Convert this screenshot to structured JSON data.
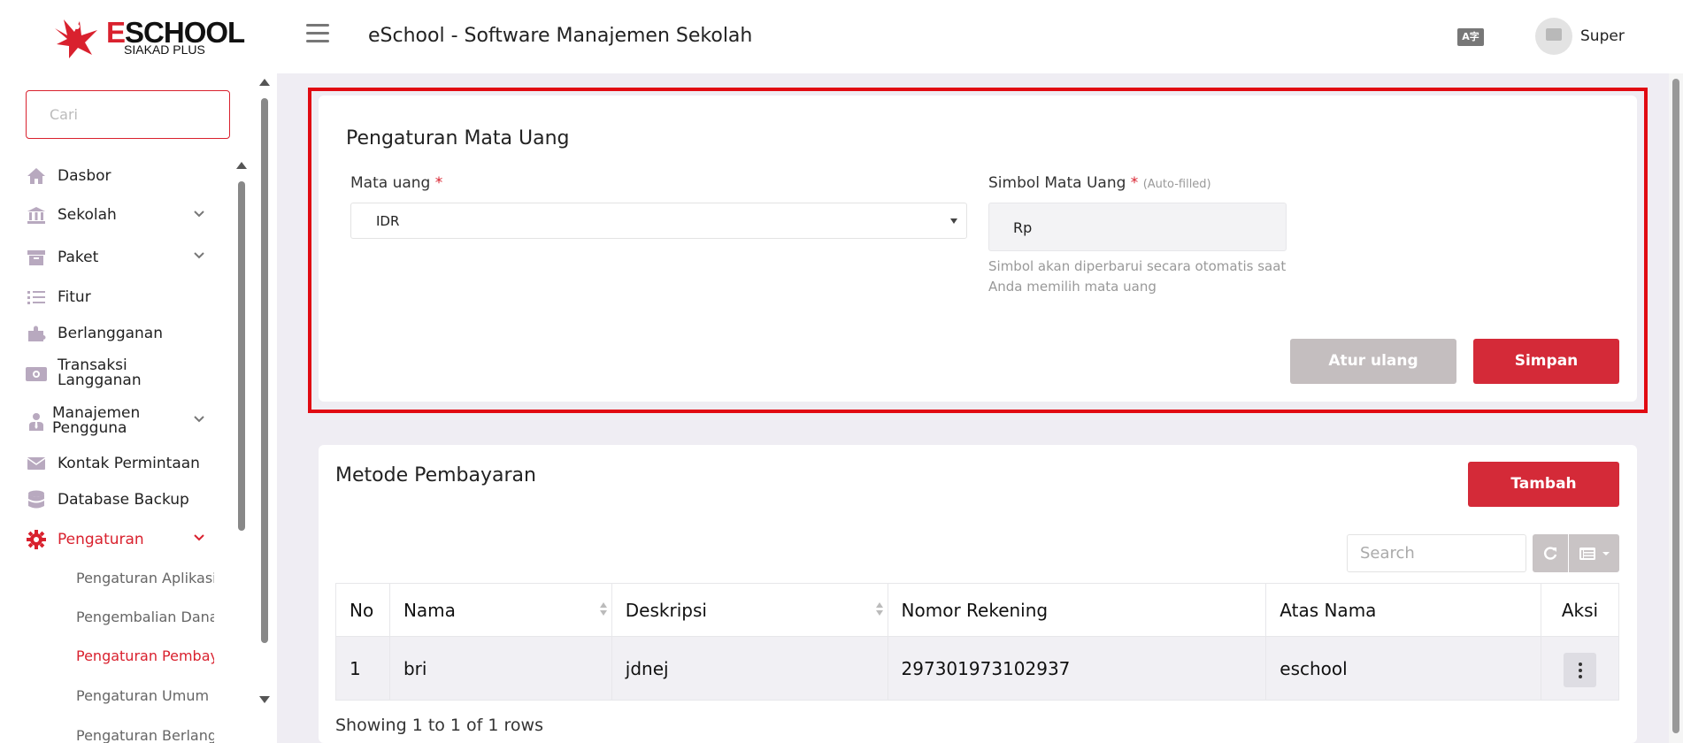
{
  "header": {
    "logo_word_first": "E",
    "logo_word_rest": "SCHOOL",
    "logo_sub": "SIAKAD PLUS",
    "app_title": "eSchool - Software Manajemen Sekolah",
    "lang_icon": "A字",
    "user_name": "Super"
  },
  "sidebar": {
    "search_placeholder": "Cari",
    "items": [
      {
        "label": "Dasbor",
        "icon": "home-icon"
      },
      {
        "label": "Sekolah",
        "icon": "school-icon"
      },
      {
        "label": "Paket",
        "icon": "box-icon"
      },
      {
        "label": "Fitur",
        "icon": "list-icon"
      },
      {
        "label": "Berlangganan",
        "icon": "puzzle-icon"
      },
      {
        "label": "Transaksi Langganan",
        "icon": "money-icon"
      },
      {
        "label": "Manajemen Pengguna",
        "icon": "user-tie-icon"
      },
      {
        "label": "Kontak Permintaan",
        "icon": "envelope-icon"
      },
      {
        "label": "Database Backup",
        "icon": "database-icon"
      },
      {
        "label": "Pengaturan",
        "icon": "gear-icon"
      }
    ],
    "sub_items": [
      {
        "label": "Pengaturan Aplikasi"
      },
      {
        "label": "Pengembalian Dana"
      },
      {
        "label": "Pengaturan Pembayaran"
      },
      {
        "label": "Pengaturan Umum"
      },
      {
        "label": "Pengaturan Berlangganan"
      }
    ]
  },
  "currency": {
    "title": "Pengaturan Mata Uang",
    "currency_label": "Mata uang",
    "required_mark": "*",
    "currency_value": "IDR",
    "symbol_label": "Simbol Mata Uang",
    "auto_filled": "(Auto-filled)",
    "symbol_value": "Rp",
    "hint": "Simbol akan diperbarui secara otomatis saat Anda memilih mata uang",
    "reset_label": "Atur ulang",
    "save_label": "Simpan"
  },
  "payment": {
    "title": "Metode Pembayaran",
    "add_label": "Tambah",
    "search_placeholder": "Search",
    "columns": [
      "No",
      "Nama",
      "Deskripsi",
      "Nomor Rekening",
      "Atas Nama",
      "Aksi"
    ],
    "rows": [
      {
        "no": "1",
        "nama": "bri",
        "deskripsi": "jdnej",
        "nomor_rekening": "297301973102937",
        "atas_nama": "eschool"
      }
    ],
    "showing": "Showing 1 to 1 of 1 rows"
  },
  "colors": {
    "accent": "#d42a38",
    "highlight": "#e10a12",
    "reset_button": "#c4bebf"
  }
}
